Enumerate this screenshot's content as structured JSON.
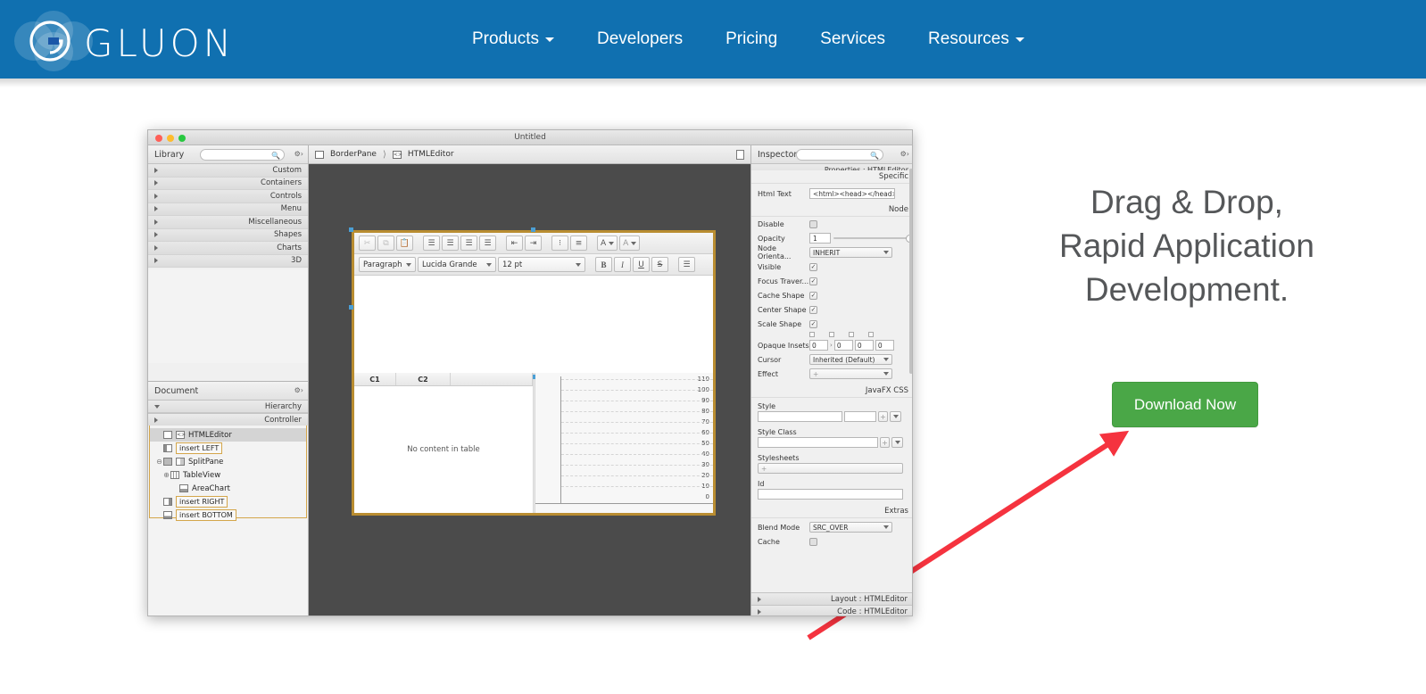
{
  "site": {
    "brand": {
      "name": "GLUON",
      "logo_icon": "gluon-logo-icon",
      "header_bg": "#1070b0"
    },
    "nav": [
      {
        "label": "Products",
        "has_caret": true
      },
      {
        "label": "Developers",
        "has_caret": false
      },
      {
        "label": "Pricing",
        "has_caret": false
      },
      {
        "label": "Services",
        "has_caret": false
      },
      {
        "label": "Resources",
        "has_caret": true
      }
    ]
  },
  "hero": {
    "line1": "Drag & Drop,",
    "line2": "Rapid Application",
    "line3": "Development.",
    "cta_label": "Download Now",
    "cta_color": "#4aa747",
    "arrow_color": "#f5333f",
    "text_color": "#555759"
  },
  "scene_builder": {
    "window_title": "Untitled",
    "library": {
      "title": "Library",
      "search_placeholder": "",
      "gear_icon": "gear-icon",
      "search_icon": "search-icon",
      "sections": [
        "Custom",
        "Containers",
        "Controls",
        "Menu",
        "Miscellaneous",
        "Shapes",
        "Charts",
        "3D"
      ]
    },
    "document": {
      "title": "Document",
      "gear_icon": "gear-icon",
      "subsection": "Hierarchy",
      "controller_label": "Controller",
      "tree": [
        {
          "label": "BorderPane",
          "depth": 0,
          "twisty": "collapse",
          "icon": "borderpane-icon",
          "selected": false,
          "chip": false
        },
        {
          "label": "HTMLEditor",
          "depth": 1,
          "twisty": "none",
          "icon": "htmleditor-icon",
          "selected": true,
          "chip": false
        },
        {
          "label": "insert LEFT",
          "depth": 1,
          "twisty": "none",
          "icon": "insert-left-icon",
          "selected": false,
          "chip": true
        },
        {
          "label": "SplitPane",
          "depth": 1,
          "twisty": "collapse",
          "icon": "splitpane-icon",
          "selected": false,
          "chip": false
        },
        {
          "label": "TableView",
          "depth": 2,
          "twisty": "expand",
          "icon": "tableview-icon",
          "selected": false,
          "chip": false
        },
        {
          "label": "AreaChart",
          "depth": 3,
          "twisty": "none",
          "icon": "areachart-icon",
          "selected": false,
          "chip": false
        },
        {
          "label": "insert RIGHT",
          "depth": 1,
          "twisty": "none",
          "icon": "insert-right-icon",
          "selected": false,
          "chip": true
        },
        {
          "label": "insert BOTTOM",
          "depth": 1,
          "twisty": "none",
          "icon": "insert-bottom-icon",
          "selected": false,
          "chip": true
        }
      ]
    },
    "content": {
      "breadcrumb": [
        "BorderPane",
        "HTMLEditor"
      ],
      "doc_icon": "document-icon",
      "html_editor": {
        "toolbar_row1": [
          {
            "name": "cut-icon",
            "glyph": "✂"
          },
          {
            "name": "copy-icon",
            "glyph": "⧉"
          },
          {
            "name": "paste-icon",
            "glyph": "Ὄb"
          },
          {
            "name": "align-left-icon",
            "glyph": "≡"
          },
          {
            "name": "align-center-icon",
            "glyph": "≡"
          },
          {
            "name": "align-right-icon",
            "glyph": "≡"
          },
          {
            "name": "align-justify-icon",
            "glyph": "≡"
          },
          {
            "name": "outdent-icon",
            "glyph": "⇤"
          },
          {
            "name": "indent-icon",
            "glyph": "⇥"
          },
          {
            "name": "bullet-list-icon",
            "glyph": "•≡"
          },
          {
            "name": "numbered-list-icon",
            "glyph": "1≡"
          }
        ],
        "text_color_label": "A",
        "highlight_color_label": "A",
        "paragraph_style": "Paragraph",
        "font_family": "Lucida Grande",
        "font_size": "12 pt",
        "bold_label": "B",
        "italic_label": "I",
        "underline_label": "U",
        "strike_label": "S"
      },
      "table_view": {
        "columns": [
          "C1",
          "C2",
          ""
        ],
        "placeholder": "No content in table"
      },
      "area_chart": {
        "y_ticks": [
          "110",
          "100",
          "90",
          "80",
          "70",
          "60",
          "50",
          "40",
          "30",
          "20",
          "10",
          "0"
        ]
      }
    },
    "inspector": {
      "title": "Inspector",
      "search_icon": "search-icon",
      "gear_icon": "gear-icon",
      "subsection": "Properties : HTMLEditor",
      "sections": {
        "specific": "Specific",
        "node": "Node",
        "javafx_css": "JavaFX CSS",
        "extras": "Extras"
      },
      "html_text": {
        "label": "Html Text",
        "value": "<html><head></head><l"
      },
      "node_props": [
        {
          "label": "Disable",
          "type": "checkbox",
          "checked": false
        },
        {
          "label": "Opacity",
          "type": "slider",
          "value": "1"
        },
        {
          "label": "Node Orienta...",
          "type": "select",
          "value": "INHERIT"
        },
        {
          "label": "Visible",
          "type": "checkbox",
          "checked": true
        },
        {
          "label": "Focus Traver...",
          "type": "checkbox",
          "checked": true
        },
        {
          "label": "Cache Shape",
          "type": "checkbox",
          "checked": true
        },
        {
          "label": "Center Shape",
          "type": "checkbox",
          "checked": true
        },
        {
          "label": "Scale Shape",
          "type": "checkbox",
          "checked": true
        }
      ],
      "opaque_insets": {
        "label": "Opaque Insets",
        "values": [
          "0",
          "0",
          "0",
          "0"
        ]
      },
      "cursor": {
        "label": "Cursor",
        "value": "Inherited (Default)"
      },
      "effect": {
        "label": "Effect",
        "value": "+"
      },
      "style": {
        "label": "Style",
        "value": ""
      },
      "style_class": {
        "label": "Style Class",
        "value": ""
      },
      "stylesheets": {
        "label": "Stylesheets",
        "value": "+"
      },
      "id": {
        "label": "Id",
        "value": ""
      },
      "blend_mode": {
        "label": "Blend Mode",
        "value": "SRC_OVER"
      },
      "cache": {
        "label": "Cache",
        "checked": false
      },
      "bottom_bars": [
        "Layout : HTMLEditor",
        "Code : HTMLEditor"
      ]
    }
  }
}
